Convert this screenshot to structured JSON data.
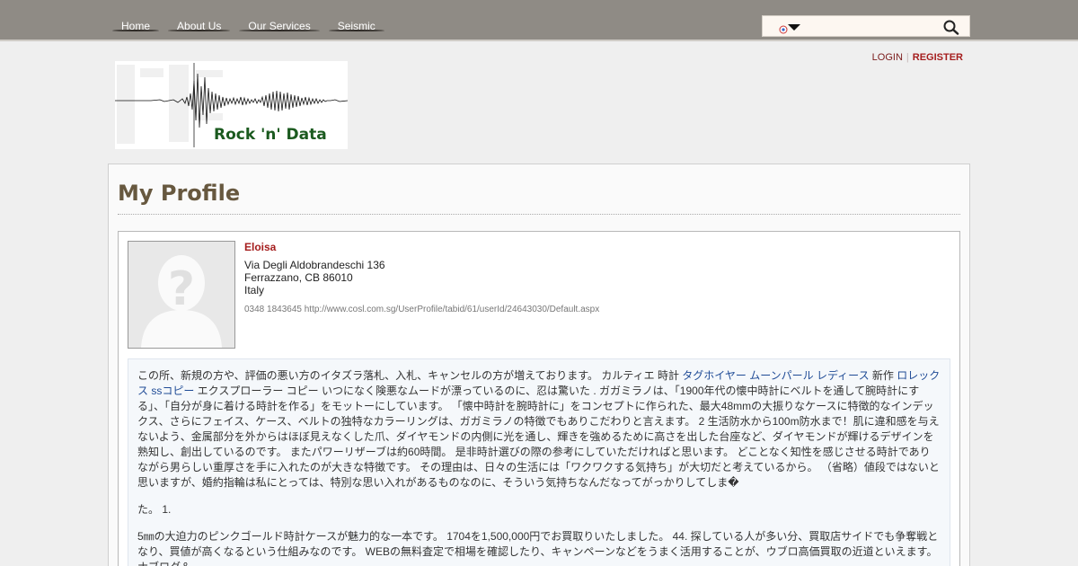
{
  "nav": {
    "items": [
      {
        "label": "Home"
      },
      {
        "label": "About Us"
      },
      {
        "label": "Our Services"
      },
      {
        "label": "Seismic"
      }
    ]
  },
  "search": {
    "value": "",
    "placeholder": ""
  },
  "account": {
    "login": "LOGIN",
    "separator": "|",
    "register": "REGISTER"
  },
  "logo": {
    "text": "Rock 'n' Data"
  },
  "page": {
    "title": "My Profile"
  },
  "profile": {
    "name": "Eloisa",
    "address": {
      "street": "Via Degli Aldobrandeschi 136",
      "city_line": "Ferrazzano, CB 86010",
      "country": "Italy"
    },
    "contact": "0348 1843645 http://www.cosl.com.sg/UserProfile/tabid/61/userId/24643030/Default.aspx"
  },
  "bio": {
    "p1_a": "この所、新規の方や、評価の悪い方のイタズラ落札、入札、キャンセルの方が増えております。 カルティエ 時計 ",
    "p1_link1": "タグホイヤー ムーンパール レディース",
    "p1_b": " 新作 ",
    "p1_link2": "ロレックス ssコピー",
    "p1_c": " エクスプローラー コピー いつになく険悪なムードが漂っているのに、忍は驚いた . ガガミラノは、「1900年代の懐中時計にベルトを通して腕時計にする」、「自分が身に着ける時計を作る」をモットーにしています。 「懐中時計を腕時計に」をコンセプトに作られた、最大48mmの大振りなケースに特徴的なインデックス、さらにフェイス、ケース、ベルトの独特なカラーリングは、ガガミラノの特徴でもありこだわりと言えます。 2 生活防水から100m防水まで！肌に違和感を与えないよう、金属部分を外からはほぼ見えなくした爪、ダイヤモンドの内側に光を通し、輝きを強めるために高さを出した台座など、ダイヤモンドが輝けるデザインを熟知し、創出しているのです。 またパワーリザーブは約60時間。 是非時計選びの際の参考にしていただければと思います。 どことなく知性を感じさせる時計でありながら男らしい重厚さを手に入れたのが大きな特徴です。 その理由は、日々の生活には「ワクワクする気持ち」が大切だと考えているから。 （省略）値段ではないと思いますが、婚約指輪は私にとっては、特別な思い入れがあるものなのに、そういう気持ちなんだなってがっかりしてしま�",
    "p2": "た。 1.",
    "p3": "5㎜の大迫力のピンクゴールド時計ケースが魅力的な一本です。 1704を1,500,000円でお買取りいたしました。 44. 探している人が多い分、買取店サイドでも争奪戦となり、買値が高くなるという仕組みなのです。 WEBの無料査定で相場を確認したり、キャンペーンなどをうまく活用することが、ウブロ高価買取の近道といえます。 ナブログ＆..."
  },
  "colors": {
    "brand_red": "#a51d1d",
    "title_brown": "#67583f",
    "nav_bar": "#8f8b85",
    "link_blue": "#1f4b96"
  }
}
